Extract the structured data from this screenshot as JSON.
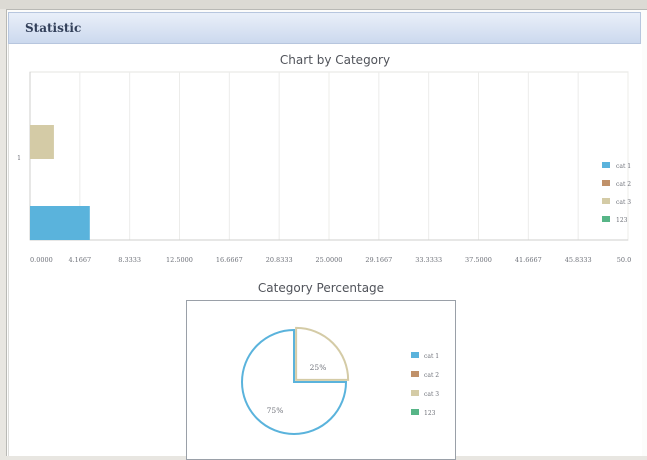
{
  "panel": {
    "title": "Statistic"
  },
  "colors": {
    "cat1": "#5ab3dc",
    "cat2": "#c0916a",
    "cat3": "#d4cba6",
    "c123": "#57b587",
    "header": "#ccd9ee"
  },
  "chart_data": [
    {
      "type": "bar",
      "orientation": "horizontal",
      "title": "Chart by Category",
      "categories": [
        "1"
      ],
      "series": [
        {
          "name": "cat 1",
          "values": [
            5
          ]
        },
        {
          "name": "cat 2",
          "values": [
            0
          ]
        },
        {
          "name": "cat 3",
          "values": [
            2
          ]
        },
        {
          "name": "123",
          "values": [
            0
          ]
        }
      ],
      "x_ticks": [
        "0.0000",
        "4.1667",
        "8.3333",
        "12.5000",
        "16.6667",
        "20.8333",
        "25.0000",
        "29.1667",
        "33.3333",
        "37.5000",
        "41.6667",
        "45.8333",
        "50.0"
      ],
      "xlim": [
        0,
        50
      ],
      "grid": true,
      "legend": "right"
    },
    {
      "type": "pie",
      "title": "Category Percentage",
      "labels": [
        "cat 1",
        "cat 2",
        "cat 3",
        "123"
      ],
      "values": [
        75,
        0,
        25,
        0
      ],
      "slice_labels": [
        "75%",
        "25%"
      ],
      "legend": "right"
    }
  ]
}
